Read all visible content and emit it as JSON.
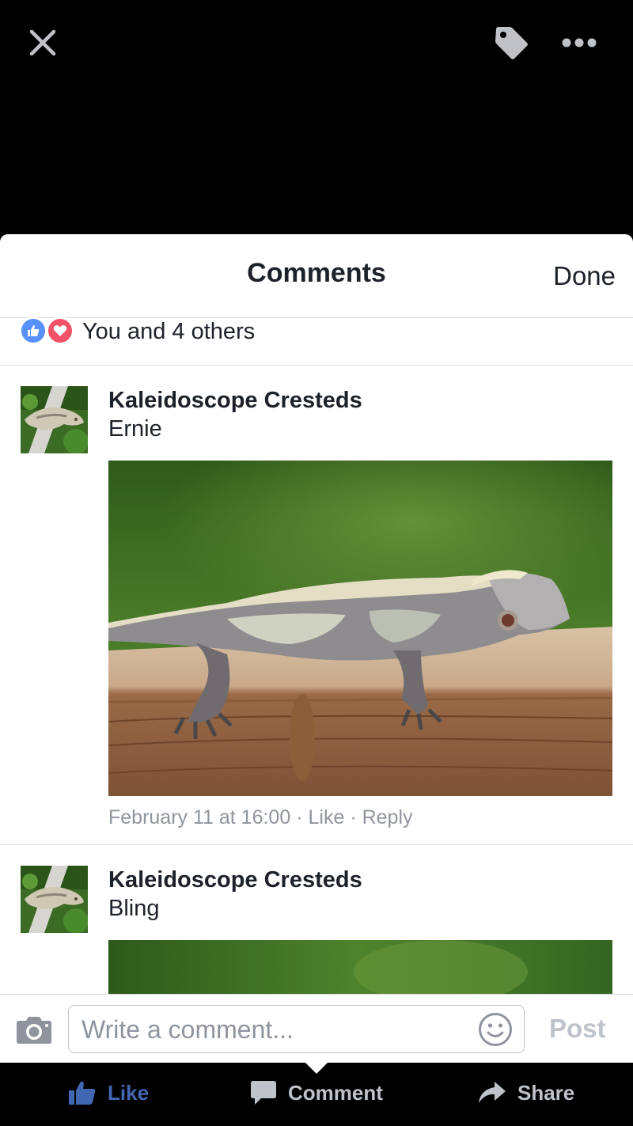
{
  "viewer": {
    "close_icon": "close-icon",
    "tag_icon": "tag-icon",
    "more_icon": "more-options-icon"
  },
  "sheet": {
    "title": "Comments",
    "done_label": "Done"
  },
  "reactions": {
    "icons": [
      "like-reaction-icon",
      "love-reaction-icon"
    ],
    "summary": "You and 4 others"
  },
  "comments": [
    {
      "author": "Kaleidoscope Cresteds",
      "text": "Ernie",
      "timestamp": "February 11 at 16:00",
      "separator": "·",
      "like_label": "Like",
      "reply_label": "Reply"
    },
    {
      "author": "Kaleidoscope Cresteds",
      "text": "Bling"
    }
  ],
  "composer": {
    "placeholder": "Write a comment...",
    "post_label": "Post"
  },
  "actions": {
    "like_label": "Like",
    "comment_label": "Comment",
    "share_label": "Share"
  },
  "colors": {
    "like_blue": "#4267b2",
    "love_red": "#f25268",
    "reaction_like_bg": "#5890ff",
    "meta_gray": "#90949c",
    "disabled_gray": "#bec3c9"
  }
}
